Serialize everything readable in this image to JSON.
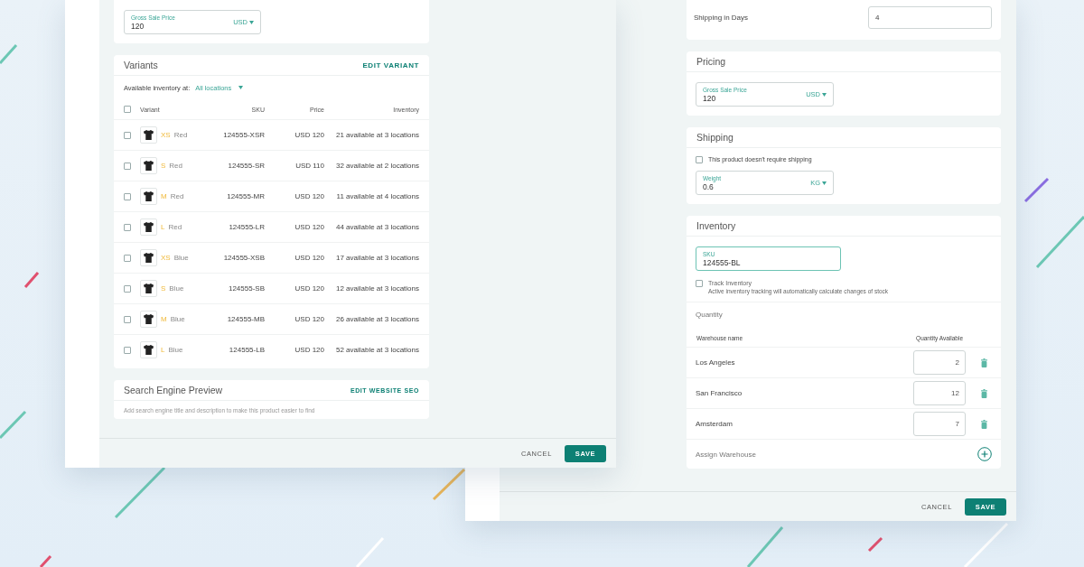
{
  "variants_window": {
    "price_field": {
      "label": "Gross Sale Price",
      "value": "120",
      "unit": "USD",
      "focused": false
    },
    "variants": {
      "title": "Variants",
      "action": "EDIT VARIANT",
      "filter_label": "Available inventory at:",
      "filter_value": "All locations",
      "select_all": {
        "checked": false
      },
      "columns": [
        "Variant",
        "SKU",
        "Price",
        "Inventory"
      ],
      "rows": [
        {
          "size": "XS",
          "option": "Red",
          "sku": "124555-XSR",
          "price": "USD 120",
          "inventory": "21 available at 3 locations",
          "checked": false
        },
        {
          "size": "S",
          "option": "Red",
          "sku": "124555-SR",
          "price": "USD 110",
          "inventory": "32 available at 2 locations",
          "checked": false
        },
        {
          "size": "M",
          "option": "Red",
          "sku": "124555-MR",
          "price": "USD 120",
          "inventory": "11 available at 4 locations",
          "checked": false
        },
        {
          "size": "L",
          "option": "Red",
          "sku": "124555-LR",
          "price": "USD 120",
          "inventory": "44 available at 3 locations",
          "checked": false
        },
        {
          "size": "XS",
          "option": "Blue",
          "sku": "124555-XSB",
          "price": "USD 120",
          "inventory": "17 available at 3 locations",
          "checked": false
        },
        {
          "size": "S",
          "option": "Blue",
          "sku": "124555-SB",
          "price": "USD 120",
          "inventory": "12 available at 3 locations",
          "checked": false
        },
        {
          "size": "M",
          "option": "Blue",
          "sku": "124555-MB",
          "price": "USD 120",
          "inventory": "26 available at 3 locations",
          "checked": false
        },
        {
          "size": "L",
          "option": "Blue",
          "sku": "124555-LB",
          "price": "USD 120",
          "inventory": "52 available at 3 locations",
          "checked": false
        }
      ]
    },
    "seo": {
      "title": "Search Engine Preview",
      "action": "EDIT WEBSITE SEO",
      "description": "Add search engine title and description to make this product easier to find"
    },
    "footer": {
      "cancel": "CANCEL",
      "save": "SAVE"
    }
  },
  "inventory_window": {
    "shipping_days": {
      "label": "Shipping in Days",
      "value": "4"
    },
    "pricing": {
      "title": "Pricing",
      "field": {
        "label": "Gross Sale Price",
        "value": "120",
        "unit": "USD",
        "focused": false
      }
    },
    "shipping": {
      "title": "Shipping",
      "no_shipping": {
        "label": "This product doesn't require shipping",
        "checked": false
      },
      "field": {
        "label": "Weight",
        "value": "0.6",
        "unit": "KG",
        "focused": false
      }
    },
    "inventory": {
      "title": "Inventory",
      "sku_field": {
        "label": "SKU",
        "value": "124555-BL",
        "focused": true
      },
      "track": {
        "label": "Track Inventory",
        "hint": "Active inventory tracking will automatically calculate changes of stock",
        "checked": false
      },
      "quantity_title": "Quantity",
      "columns": [
        "Warehouse name",
        "Quantity Available"
      ],
      "warehouses": [
        {
          "name": "Los Angeles",
          "quantity": "2"
        },
        {
          "name": "San Francisco",
          "quantity": "12"
        },
        {
          "name": "Amsterdam",
          "quantity": "7"
        }
      ],
      "assign": "Assign Warehouse"
    },
    "footer": {
      "cancel": "CANCEL",
      "save": "SAVE"
    }
  }
}
